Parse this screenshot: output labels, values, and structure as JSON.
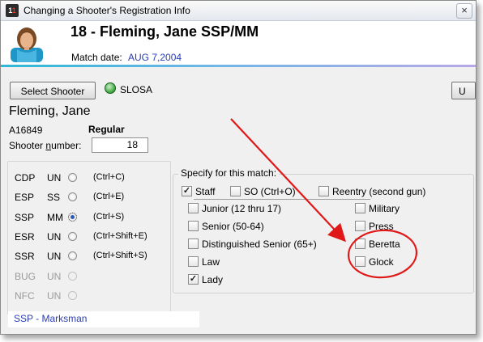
{
  "window": {
    "title": "Changing a Shooter's Registration Info",
    "close_label": "×"
  },
  "header": {
    "shooter_line": "18 - Fleming, Jane   SSP/MM",
    "match_date_label": "Match date:",
    "match_date_value": "AUG  7,2004"
  },
  "toolbar": {
    "select_button": "Select Shooter",
    "status_label": "SLOSA",
    "right_button": "U"
  },
  "shooter": {
    "name": "Fleming, Jane",
    "id": "A16849",
    "category": "Regular",
    "number_label_pre": "Shooter ",
    "number_label_u": "n",
    "number_label_post": "umber:",
    "number_value": "18"
  },
  "divisions": [
    {
      "code": "CDP",
      "class": "UN",
      "shortcut": "(Ctrl+C)",
      "selected": false,
      "enabled": true
    },
    {
      "code": "ESP",
      "class": "SS",
      "shortcut": "(Ctrl+E)",
      "selected": false,
      "enabled": true
    },
    {
      "code": "SSP",
      "class": "MM",
      "shortcut": "(Ctrl+S)",
      "selected": true,
      "enabled": true
    },
    {
      "code": "ESR",
      "class": "UN",
      "shortcut": "(Ctrl+Shift+E)",
      "selected": false,
      "enabled": true
    },
    {
      "code": "SSR",
      "class": "UN",
      "shortcut": "(Ctrl+Shift+S)",
      "selected": false,
      "enabled": true
    },
    {
      "code": "BUG",
      "class": "UN",
      "shortcut": "",
      "selected": false,
      "enabled": false
    },
    {
      "code": "NFC",
      "class": "UN",
      "shortcut": "",
      "selected": false,
      "enabled": false
    }
  ],
  "match_options": {
    "title": "Specify for this match:",
    "staff": {
      "label": "Staff",
      "checked": true
    },
    "so": {
      "label": "SO (Ctrl+O)",
      "checked": false
    },
    "reentry": {
      "label": "Reentry (second gun)",
      "checked": false
    },
    "junior": {
      "label": "Junior (12 thru 17)",
      "checked": false
    },
    "senior": {
      "label": "Senior (50-64)",
      "checked": false
    },
    "distinguished": {
      "label": "Distinguished Senior (65+)",
      "checked": false
    },
    "law": {
      "label": "Law",
      "checked": false
    },
    "lady": {
      "label": "Lady",
      "checked": true
    },
    "military": {
      "label": "Military",
      "checked": false
    },
    "press": {
      "label": "Press",
      "checked": false
    },
    "beretta": {
      "label": "Beretta",
      "checked": false
    },
    "glock": {
      "label": "Glock",
      "checked": false
    }
  },
  "footer": {
    "classification_link": "SSP - Marksman"
  },
  "colors": {
    "link_blue": "#2a3db5",
    "annotation_red": "#e01818",
    "accent_cyan": "#2fb8d6"
  }
}
